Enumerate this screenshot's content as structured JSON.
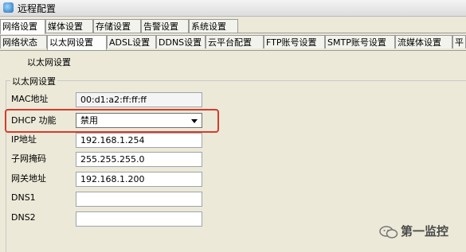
{
  "window": {
    "title": "远程配置"
  },
  "main_tabs": [
    {
      "label": "网络设置",
      "active": true
    },
    {
      "label": "媒体设置"
    },
    {
      "label": "存储设置"
    },
    {
      "label": "告警设置"
    },
    {
      "label": "系统设置"
    }
  ],
  "sub_tabs": [
    {
      "label": "网络状态"
    },
    {
      "label": "以太网设置",
      "active": true
    },
    {
      "label": "ADSL设置"
    },
    {
      "label": "DDNS设置"
    },
    {
      "label": "云平台配置"
    },
    {
      "label": "FTP账号设置"
    },
    {
      "label": "SMTP账号设置"
    },
    {
      "label": "流媒体设置"
    },
    {
      "label": "平"
    }
  ],
  "page_heading": "以太网设置",
  "group": {
    "title": "以太网设置",
    "fields": [
      {
        "label": "MAC地址",
        "value": "00:d1:a2:ff:ff:ff"
      },
      {
        "label": "DHCP 功能",
        "value": "禁用"
      },
      {
        "label": "IP地址",
        "value": "192.168.1.254"
      },
      {
        "label": "子网掩码",
        "value": "255.255.255.0"
      },
      {
        "label": "网关地址",
        "value": "192.168.1.200"
      },
      {
        "label": "DNS1",
        "value": ""
      },
      {
        "label": "DNS2",
        "value": ""
      }
    ]
  },
  "watermark": {
    "text": "第一监控"
  },
  "colors": {
    "highlight": "#d93a2b",
    "background": "#ece9d8"
  }
}
